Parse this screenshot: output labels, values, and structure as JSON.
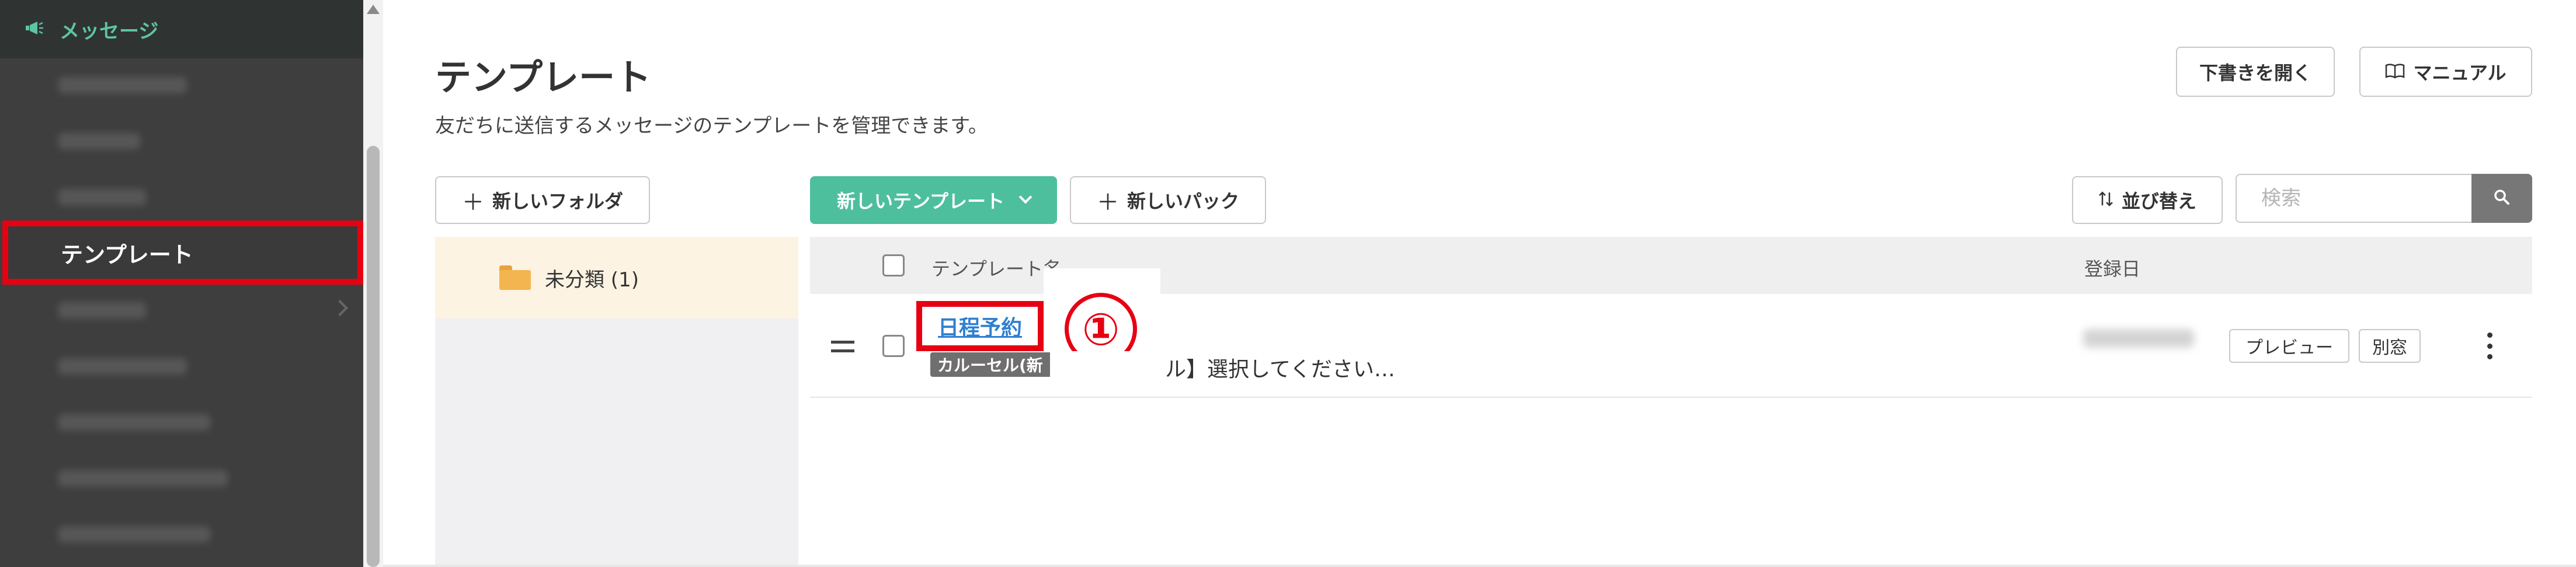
{
  "sidebar": {
    "section_title": "メッセージ",
    "active_item": "テンプレート"
  },
  "page": {
    "title": "テンプレート",
    "description": "友だちに送信するメッセージのテンプレートを管理できます。",
    "open_drafts_label": "下書きを開く",
    "manual_label": "マニュアル"
  },
  "toolbar": {
    "new_folder_label": "新しいフォルダ",
    "new_template_label": "新しいテンプレート",
    "new_pack_label": "新しいパック",
    "sort_label": "並び替え",
    "search_placeholder": "検索"
  },
  "folders": [
    {
      "label": "未分類 (1)"
    }
  ],
  "table": {
    "col_name": "テンプレート名",
    "col_date": "登録日",
    "rows": [
      {
        "name": "日程予約",
        "tag": "カルーセル(新",
        "preview": "ル】選択してください…",
        "preview_button": "プレビュー",
        "other_window_button": "別窓"
      }
    ]
  },
  "annotation": {
    "step": "①",
    "highlight_color": "#e60012"
  },
  "colors": {
    "accent": "#4dbf9d",
    "sidebar_bg": "#3e3e3e",
    "link": "#2f7fd1"
  }
}
